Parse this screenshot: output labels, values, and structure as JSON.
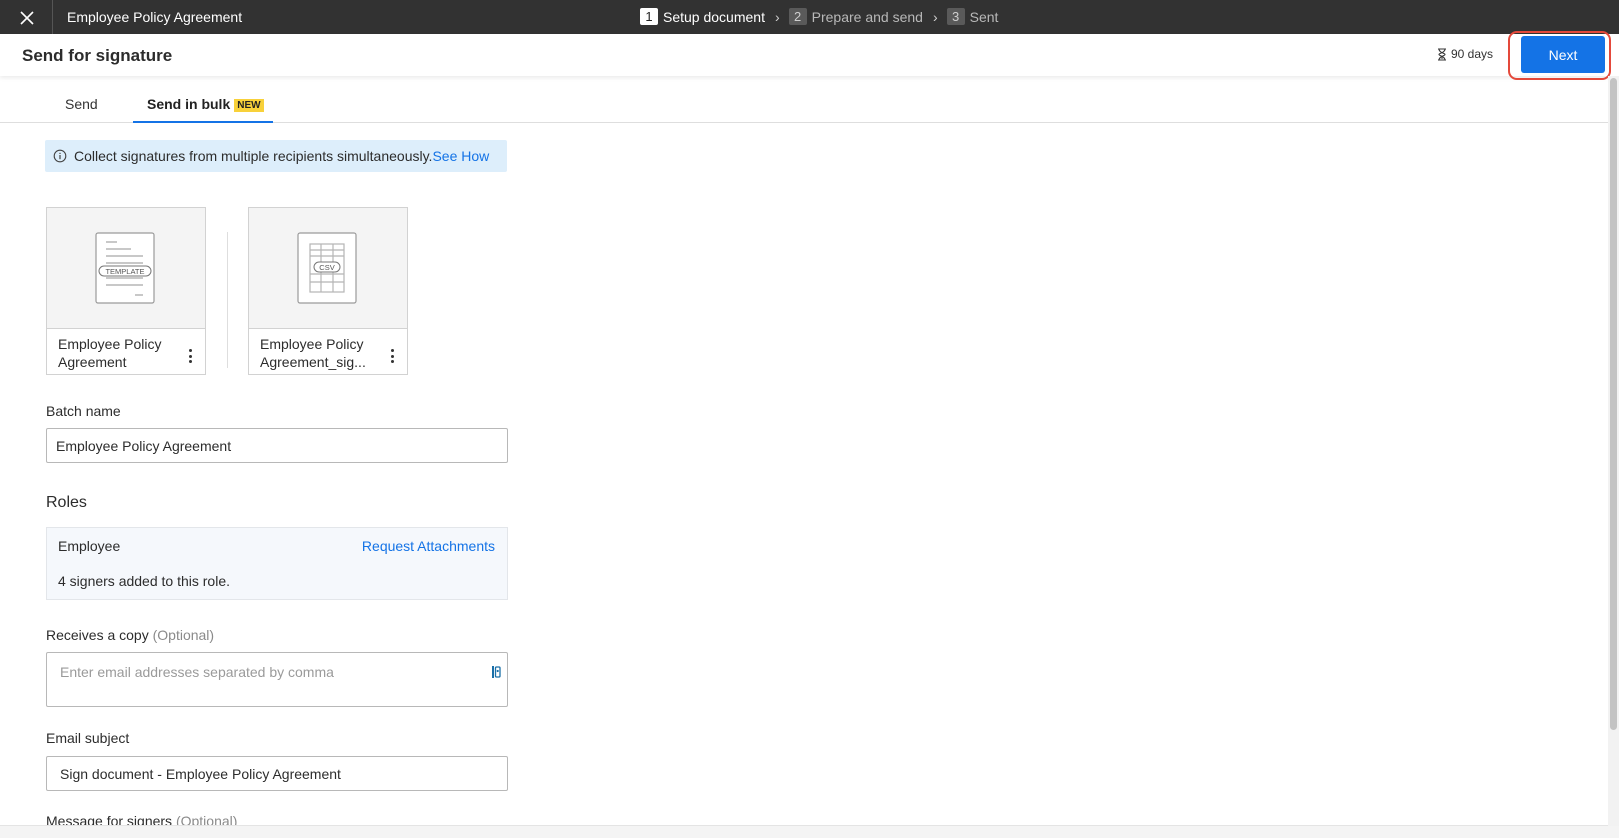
{
  "topbar": {
    "doc_title": "Employee Policy Agreement",
    "steps": [
      {
        "num": "1",
        "label": "Setup document",
        "active": true
      },
      {
        "num": "2",
        "label": "Prepare and send",
        "active": false
      },
      {
        "num": "3",
        "label": "Sent",
        "active": false
      }
    ],
    "chevron": "›"
  },
  "header": {
    "title": "Send for signature",
    "expiry": "90 days",
    "next_label": "Next",
    "highlight_color": "#e4493b",
    "accent_color": "#1473e6"
  },
  "tabs": {
    "send": "Send",
    "bulk": "Send in bulk",
    "badge": "NEW"
  },
  "banner": {
    "text": "Collect signatures from multiple recipients simultaneously.",
    "link": "See How"
  },
  "cards": [
    {
      "icon": "template-file-icon",
      "icon_text": "TEMPLATE",
      "label": "Employee Policy Agreement"
    },
    {
      "icon": "csv-file-icon",
      "icon_text": "CSV",
      "label": "Employee Policy Agreement_sig..."
    }
  ],
  "batch": {
    "label": "Batch name",
    "value": "Employee Policy Agreement"
  },
  "roles": {
    "title": "Roles",
    "role_name": "Employee",
    "request_link": "Request Attachments",
    "count_text": "4 signers added to this role."
  },
  "copy": {
    "label": "Receives a copy",
    "optional": "(Optional)",
    "placeholder": "Enter email addresses separated by comma"
  },
  "subject": {
    "label": "Email subject",
    "value": "Sign document - Employee Policy Agreement"
  },
  "message": {
    "label": "Message for signers",
    "optional": "(Optional)"
  }
}
